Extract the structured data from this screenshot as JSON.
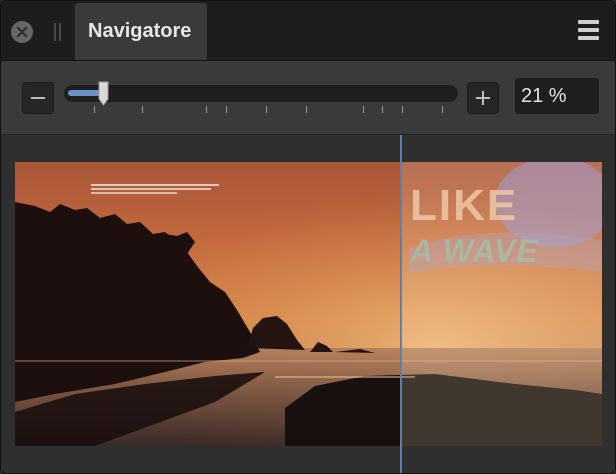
{
  "panel": {
    "tab_title": "Navigatore",
    "icons": {
      "close": "close-icon",
      "grip": "grip-icon",
      "menu": "hamburger-menu-icon"
    }
  },
  "zoom": {
    "minus_icon": "minus-icon",
    "plus_icon": "plus-icon",
    "value_text": "21 %",
    "slider_fraction": 0.09,
    "accent_color": "#6d90c7"
  },
  "preview": {
    "headline_line1": "LIKE",
    "headline_line2": "A WAVE",
    "view_rect_color": "#5f7fa8"
  }
}
